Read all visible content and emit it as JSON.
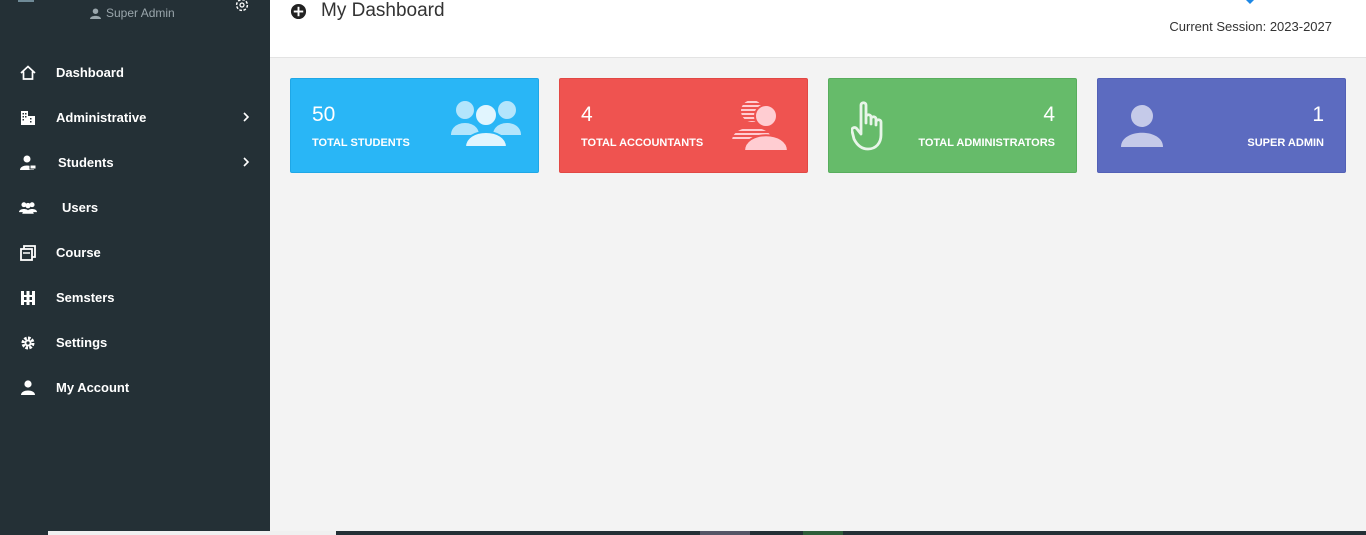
{
  "sidebar": {
    "user_role": "Super Admin",
    "items": [
      {
        "label": "Dashboard",
        "icon": "home-icon",
        "has_submenu": false
      },
      {
        "label": "Administrative",
        "icon": "building-icon",
        "has_submenu": true
      },
      {
        "label": "Students",
        "icon": "student-icon",
        "has_submenu": true
      },
      {
        "label": "Users",
        "icon": "users-icon",
        "has_submenu": false
      },
      {
        "label": "Course",
        "icon": "course-icon",
        "has_submenu": false
      },
      {
        "label": "Semsters",
        "icon": "semesters-icon",
        "has_submenu": false
      },
      {
        "label": "Settings",
        "icon": "gear-icon",
        "has_submenu": false
      },
      {
        "label": "My Account",
        "icon": "user-icon",
        "has_submenu": false
      }
    ]
  },
  "header": {
    "title": "My Dashboard",
    "session": "Current Session: 2023-2027"
  },
  "cards": {
    "students": {
      "count": "50",
      "label": "TOTAL STUDENTS",
      "color": "#29b6f6",
      "icon": "users-icon"
    },
    "accountants": {
      "count": "4",
      "label": "TOTAL ACCOUNTANTS",
      "color": "#ef5350",
      "icon": "accountants-icon"
    },
    "admins": {
      "count": "4",
      "label": "TOTAL ADMINISTRATORS",
      "color": "#66bb6a",
      "icon": "hand-pointer-icon"
    },
    "super_admin": {
      "count": "1",
      "label": "SUPER ADMIN",
      "color": "#5c6bc0",
      "icon": "user-icon"
    }
  },
  "colors": {
    "sidebar_bg": "#243036",
    "page_bg": "#f3f3f3",
    "accent": "#1e88e5"
  }
}
